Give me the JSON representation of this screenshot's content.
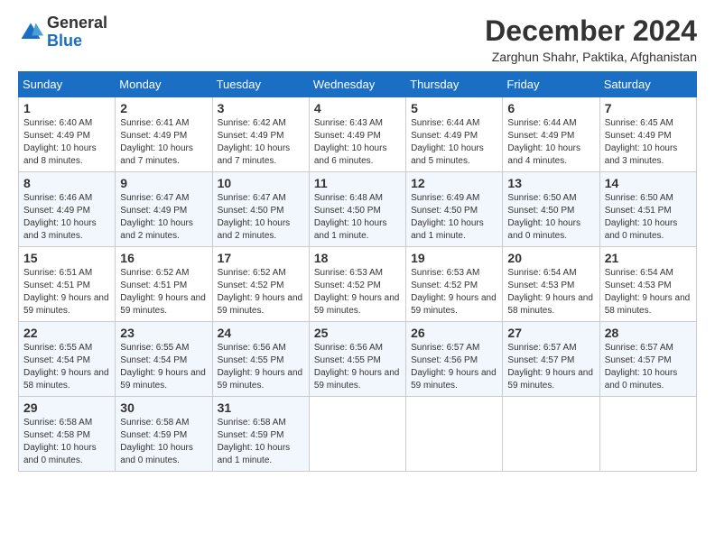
{
  "header": {
    "logo_general": "General",
    "logo_blue": "Blue",
    "month_title": "December 2024",
    "location": "Zarghun Shahr, Paktika, Afghanistan"
  },
  "days_of_week": [
    "Sunday",
    "Monday",
    "Tuesday",
    "Wednesday",
    "Thursday",
    "Friday",
    "Saturday"
  ],
  "weeks": [
    [
      {
        "day": "1",
        "sunrise": "6:40 AM",
        "sunset": "4:49 PM",
        "daylight": "10 hours and 8 minutes."
      },
      {
        "day": "2",
        "sunrise": "6:41 AM",
        "sunset": "4:49 PM",
        "daylight": "10 hours and 7 minutes."
      },
      {
        "day": "3",
        "sunrise": "6:42 AM",
        "sunset": "4:49 PM",
        "daylight": "10 hours and 7 minutes."
      },
      {
        "day": "4",
        "sunrise": "6:43 AM",
        "sunset": "4:49 PM",
        "daylight": "10 hours and 6 minutes."
      },
      {
        "day": "5",
        "sunrise": "6:44 AM",
        "sunset": "4:49 PM",
        "daylight": "10 hours and 5 minutes."
      },
      {
        "day": "6",
        "sunrise": "6:44 AM",
        "sunset": "4:49 PM",
        "daylight": "10 hours and 4 minutes."
      },
      {
        "day": "7",
        "sunrise": "6:45 AM",
        "sunset": "4:49 PM",
        "daylight": "10 hours and 3 minutes."
      }
    ],
    [
      {
        "day": "8",
        "sunrise": "6:46 AM",
        "sunset": "4:49 PM",
        "daylight": "10 hours and 3 minutes."
      },
      {
        "day": "9",
        "sunrise": "6:47 AM",
        "sunset": "4:49 PM",
        "daylight": "10 hours and 2 minutes."
      },
      {
        "day": "10",
        "sunrise": "6:47 AM",
        "sunset": "4:50 PM",
        "daylight": "10 hours and 2 minutes."
      },
      {
        "day": "11",
        "sunrise": "6:48 AM",
        "sunset": "4:50 PM",
        "daylight": "10 hours and 1 minute."
      },
      {
        "day": "12",
        "sunrise": "6:49 AM",
        "sunset": "4:50 PM",
        "daylight": "10 hours and 1 minute."
      },
      {
        "day": "13",
        "sunrise": "6:50 AM",
        "sunset": "4:50 PM",
        "daylight": "10 hours and 0 minutes."
      },
      {
        "day": "14",
        "sunrise": "6:50 AM",
        "sunset": "4:51 PM",
        "daylight": "10 hours and 0 minutes."
      }
    ],
    [
      {
        "day": "15",
        "sunrise": "6:51 AM",
        "sunset": "4:51 PM",
        "daylight": "9 hours and 59 minutes."
      },
      {
        "day": "16",
        "sunrise": "6:52 AM",
        "sunset": "4:51 PM",
        "daylight": "9 hours and 59 minutes."
      },
      {
        "day": "17",
        "sunrise": "6:52 AM",
        "sunset": "4:52 PM",
        "daylight": "9 hours and 59 minutes."
      },
      {
        "day": "18",
        "sunrise": "6:53 AM",
        "sunset": "4:52 PM",
        "daylight": "9 hours and 59 minutes."
      },
      {
        "day": "19",
        "sunrise": "6:53 AM",
        "sunset": "4:52 PM",
        "daylight": "9 hours and 59 minutes."
      },
      {
        "day": "20",
        "sunrise": "6:54 AM",
        "sunset": "4:53 PM",
        "daylight": "9 hours and 58 minutes."
      },
      {
        "day": "21",
        "sunrise": "6:54 AM",
        "sunset": "4:53 PM",
        "daylight": "9 hours and 58 minutes."
      }
    ],
    [
      {
        "day": "22",
        "sunrise": "6:55 AM",
        "sunset": "4:54 PM",
        "daylight": "9 hours and 58 minutes."
      },
      {
        "day": "23",
        "sunrise": "6:55 AM",
        "sunset": "4:54 PM",
        "daylight": "9 hours and 59 minutes."
      },
      {
        "day": "24",
        "sunrise": "6:56 AM",
        "sunset": "4:55 PM",
        "daylight": "9 hours and 59 minutes."
      },
      {
        "day": "25",
        "sunrise": "6:56 AM",
        "sunset": "4:55 PM",
        "daylight": "9 hours and 59 minutes."
      },
      {
        "day": "26",
        "sunrise": "6:57 AM",
        "sunset": "4:56 PM",
        "daylight": "9 hours and 59 minutes."
      },
      {
        "day": "27",
        "sunrise": "6:57 AM",
        "sunset": "4:57 PM",
        "daylight": "9 hours and 59 minutes."
      },
      {
        "day": "28",
        "sunrise": "6:57 AM",
        "sunset": "4:57 PM",
        "daylight": "10 hours and 0 minutes."
      }
    ],
    [
      {
        "day": "29",
        "sunrise": "6:58 AM",
        "sunset": "4:58 PM",
        "daylight": "10 hours and 0 minutes."
      },
      {
        "day": "30",
        "sunrise": "6:58 AM",
        "sunset": "4:59 PM",
        "daylight": "10 hours and 0 minutes."
      },
      {
        "day": "31",
        "sunrise": "6:58 AM",
        "sunset": "4:59 PM",
        "daylight": "10 hours and 1 minute."
      },
      null,
      null,
      null,
      null
    ]
  ]
}
